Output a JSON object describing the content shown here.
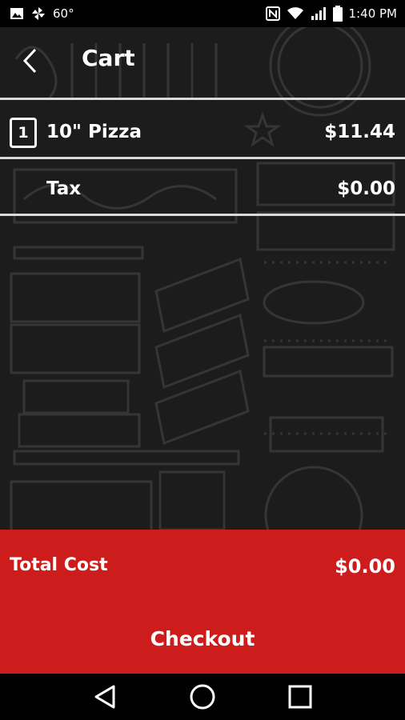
{
  "status_bar": {
    "temperature": "60°",
    "time": "1:40 PM"
  },
  "header": {
    "title": "Cart"
  },
  "cart": {
    "items": [
      {
        "quantity": "1",
        "name": "10\" Pizza",
        "price": "$11.44"
      }
    ],
    "tax_label": "Tax",
    "tax_value": "$0.00"
  },
  "footer": {
    "total_label": "Total Cost",
    "total_value": "$0.00",
    "checkout_label": "Checkout"
  },
  "colors": {
    "accent": "#cc1c1c",
    "background": "#1c1c1c"
  },
  "icons": {
    "status_left": [
      "image-icon",
      "pinwheel-icon"
    ],
    "status_right": [
      "nfc-icon",
      "wifi-icon",
      "signal-icon",
      "battery-icon"
    ],
    "nav": [
      "back-triangle-icon",
      "home-circle-icon",
      "recents-square-icon"
    ]
  }
}
